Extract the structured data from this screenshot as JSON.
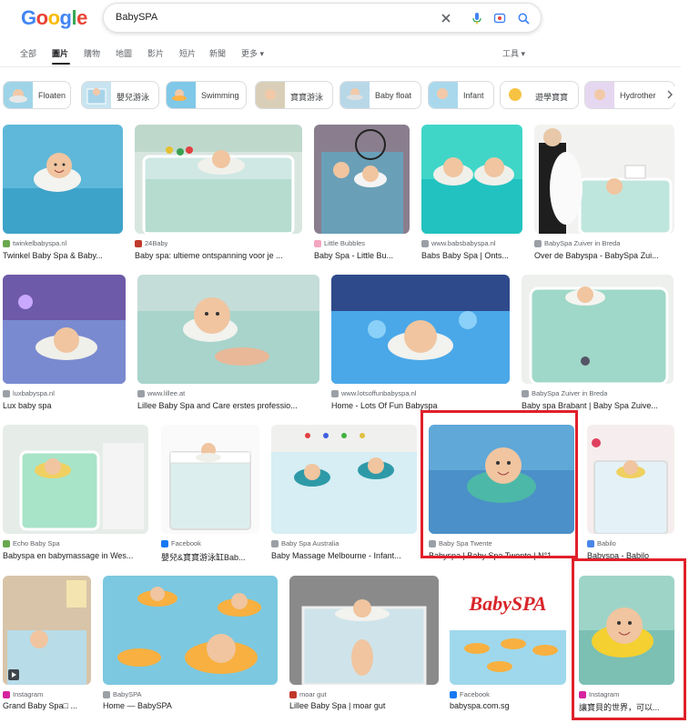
{
  "logo_letters": [
    "G",
    "o",
    "o",
    "g",
    "l",
    "e"
  ],
  "logo_colors": [
    "#4285f4",
    "#ea4335",
    "#fbbc05",
    "#4285f4",
    "#34a853",
    "#ea4335"
  ],
  "search": {
    "query": "BabySPA"
  },
  "tabs": [
    "全部",
    "圖片",
    "購物",
    "地圖",
    "影片",
    "短片",
    "新聞",
    "更多"
  ],
  "tools_label": "工具",
  "chips": [
    {
      "label": "Floaten"
    },
    {
      "label": "嬰兒游泳"
    },
    {
      "label": "Swimming"
    },
    {
      "label": "寶寶游泳"
    },
    {
      "label": "Baby float"
    },
    {
      "label": "Infant"
    },
    {
      "label": "遊學寶寶"
    },
    {
      "label": "Hydrother"
    }
  ],
  "results": [
    {
      "source": "twinkelbabyspa.nl",
      "title": "Twinkel Baby Spa & Baby...",
      "fav": "#6aa84f"
    },
    {
      "source": "24Baby",
      "title": "Baby spa: ultieme ontspanning voor je ...",
      "fav": "#c0392b"
    },
    {
      "source": "Little Bubbles",
      "title": "Baby Spa - Little Bu...",
      "fav": "#f4a6c0"
    },
    {
      "source": "www.babsbabyspa.nl",
      "title": "Babs Baby Spa | Onts...",
      "fav": "#9aa0a6"
    },
    {
      "source": "BabySpa Zuiver in Breda",
      "title": "Over de Babyspa - BabySpa Zui...",
      "fav": "#9aa0a6"
    },
    {
      "source": "luxbabyspa.nl",
      "title": "Lux baby spa",
      "fav": "#9aa0a6"
    },
    {
      "source": "www.lillee.at",
      "title": "Lillee Baby Spa and Care erstes professio...",
      "fav": "#9aa0a6"
    },
    {
      "source": "www.lotsoffunbabyspa.nl",
      "title": "Home - Lots Of Fun Babyspa",
      "fav": "#9aa0a6"
    },
    {
      "source": "BabySpa Zuiver in Breda",
      "title": "Baby spa Brabant | Baby Spa Zuive...",
      "fav": "#9aa0a6"
    },
    {
      "source": "Echo Baby Spa",
      "title": "Babyspa en babymassage in Wes...",
      "fav": "#6aa84f"
    },
    {
      "source": "Facebook",
      "title": "嬰兒&寶寶游泳缸Bab...",
      "fav": "#1877f2"
    },
    {
      "source": "Baby Spa Australia",
      "title": "Baby Massage Melbourne - Infant...",
      "fav": "#9aa0a6"
    },
    {
      "source": "Baby Spa Twente",
      "title": "Babyspa | Baby Spa Twente | N°1",
      "fav": "#9aa0a6"
    },
    {
      "source": "Babilo",
      "title": "Babyspa - Babilo",
      "fav": "#4a86e8"
    },
    {
      "source": "Instagram",
      "title": "Grand Baby Spa□ ...",
      "fav": "#d6249f"
    },
    {
      "source": "BabySPA",
      "title": "Home — BabySPA",
      "fav": "#9aa0a6"
    },
    {
      "source": "moar gut",
      "title": "Lillee Baby Spa | moar gut",
      "fav": "#c0392b"
    },
    {
      "source": "Facebook",
      "title": "babyspa.com.sg",
      "fav": "#1877f2"
    },
    {
      "source": "Instagram",
      "title": "讓寶貝的世界，可以...",
      "fav": "#d6249f"
    }
  ],
  "babyspa_logo_text": "BabySPA"
}
